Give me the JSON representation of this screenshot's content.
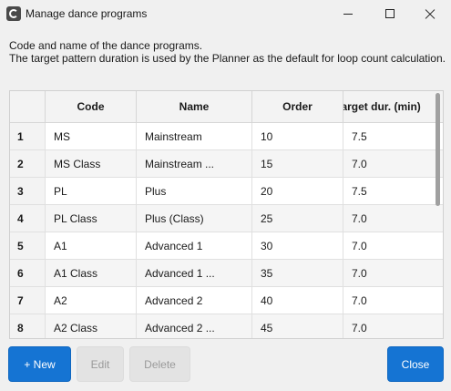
{
  "window": {
    "title": "Manage dance programs",
    "app_icon": "app-logo-icon",
    "controls": [
      "minimize-icon",
      "maximize-icon",
      "close-icon"
    ]
  },
  "description": {
    "line1": "Code and name of the dance programs.",
    "line2": "The target pattern duration is used by the Planner as the default for loop count calculation."
  },
  "table": {
    "columns": [
      "",
      "Code",
      "Name",
      "Order",
      "Target dur. (min)"
    ],
    "rows": [
      {
        "num": "1",
        "code": "MS",
        "name": "Mainstream",
        "order": "10",
        "target": "7.5"
      },
      {
        "num": "2",
        "code": "MS Class",
        "name": "Mainstream ...",
        "order": "15",
        "target": "7.0"
      },
      {
        "num": "3",
        "code": "PL",
        "name": "Plus",
        "order": "20",
        "target": "7.5"
      },
      {
        "num": "4",
        "code": "PL Class",
        "name": "Plus (Class)",
        "order": "25",
        "target": "7.0"
      },
      {
        "num": "5",
        "code": "A1",
        "name": "Advanced 1",
        "order": "30",
        "target": "7.0"
      },
      {
        "num": "6",
        "code": "A1 Class",
        "name": "Advanced 1 ...",
        "order": "35",
        "target": "7.0"
      },
      {
        "num": "7",
        "code": "A2",
        "name": "Advanced 2",
        "order": "40",
        "target": "7.0"
      },
      {
        "num": "8",
        "code": "A2 Class",
        "name": "Advanced 2 ...",
        "order": "45",
        "target": "7.0"
      }
    ]
  },
  "buttons": {
    "new": "+ New",
    "edit": "Edit",
    "delete": "Delete",
    "close": "Close"
  },
  "colors": {
    "accent": "#1574d3",
    "disabled_bg": "#e3e3e3",
    "disabled_text": "#9a9a9a"
  }
}
